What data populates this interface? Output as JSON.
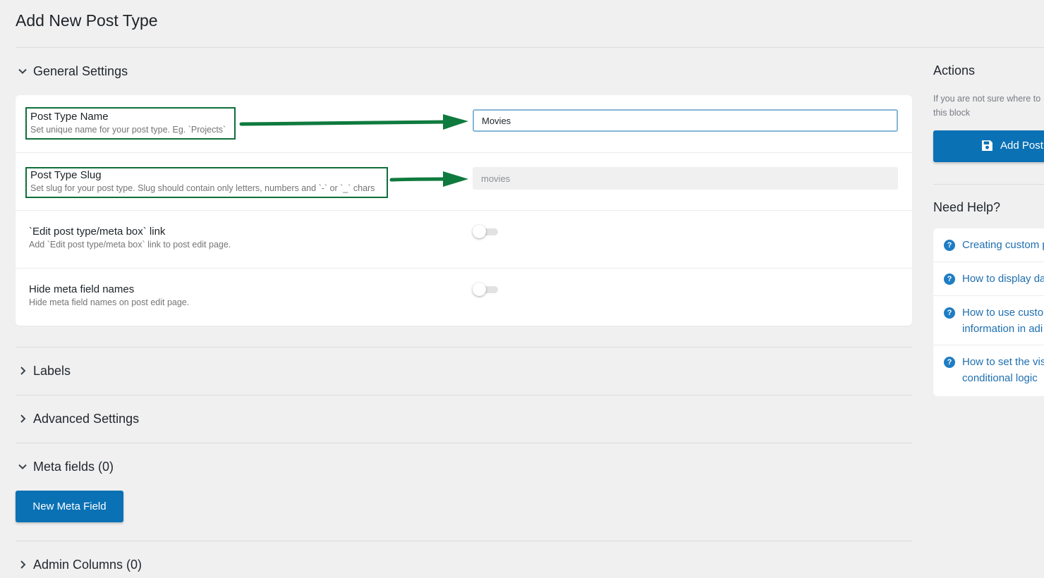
{
  "page": {
    "title": "Add New Post Type"
  },
  "sections": {
    "general": {
      "label": "General Settings",
      "expanded": true
    },
    "labels": {
      "label": "Labels",
      "expanded": false
    },
    "advanced": {
      "label": "Advanced Settings",
      "expanded": false
    },
    "meta_fields": {
      "label": "Meta fields (0)",
      "expanded": true
    },
    "admin_columns": {
      "label": "Admin Columns (0)",
      "expanded": false
    }
  },
  "general_settings": {
    "post_type_name": {
      "title": "Post Type Name",
      "description": "Set unique name for your post type. Eg. `Projects`",
      "value": "Movies"
    },
    "post_type_slug": {
      "title": "Post Type Slug",
      "description": "Set slug for your post type. Slug should contain only letters, numbers and `-` or `_` chars",
      "value": "movies"
    },
    "edit_link": {
      "title": "`Edit post type/meta box` link",
      "description": "Add `Edit post type/meta box` link to post edit page.",
      "enabled": false
    },
    "hide_meta_names": {
      "title": "Hide meta field names",
      "description": "Hide meta field names on post edit page.",
      "enabled": false
    }
  },
  "meta_fields": {
    "new_button_label": "New Meta Field"
  },
  "sidebar": {
    "actions_heading": "Actions",
    "actions_note": "If you are not sure where to this block",
    "add_button_label": "Add Post",
    "need_help_heading": "Need Help?",
    "help_links": [
      {
        "label": "Creating custom p"
      },
      {
        "label": "How to display da"
      },
      {
        "label": "How to use custo information in adi"
      },
      {
        "label": "How to set the vis conditional logic"
      }
    ]
  },
  "colors": {
    "primary": "#0a71b4",
    "annotation_green": "#0f6e3a",
    "link": "#1e6fb0"
  }
}
